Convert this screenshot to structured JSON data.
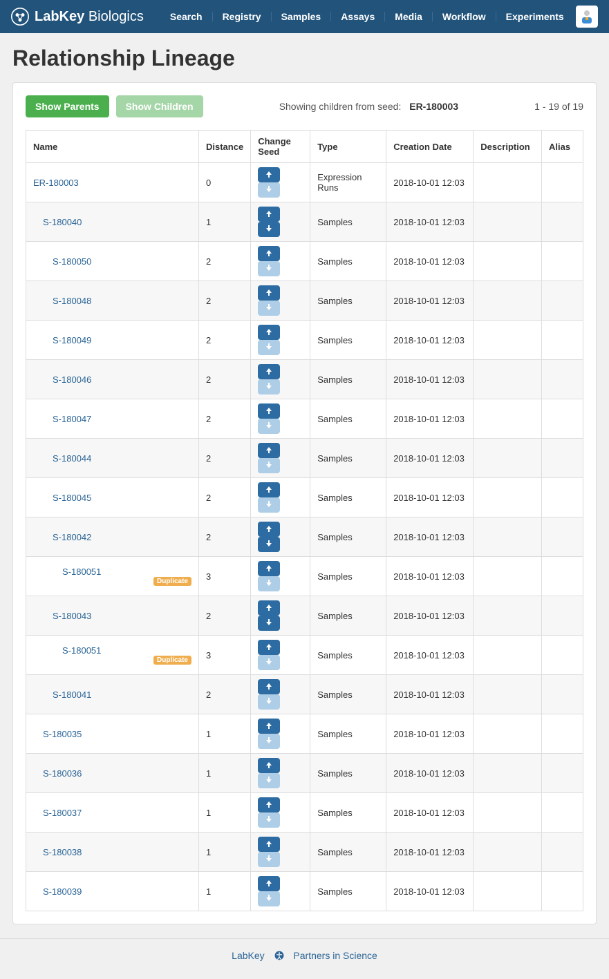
{
  "brand": {
    "name1": "LabKey",
    "name2": "Biologics"
  },
  "nav": [
    "Search",
    "Registry",
    "Samples",
    "Assays",
    "Media",
    "Workflow",
    "Experiments"
  ],
  "page_title": "Relationship Lineage",
  "buttons": {
    "parents": "Show Parents",
    "children": "Show Children"
  },
  "seed_label": "Showing children from seed:",
  "seed_value": "ER-180003",
  "count": "1 - 19 of 19",
  "columns": [
    "Name",
    "Distance",
    "Change Seed",
    "Type",
    "Creation Date",
    "Description",
    "Alias"
  ],
  "rows": [
    {
      "name": "ER-180003",
      "indent": 0,
      "distance": "0",
      "up": true,
      "down": false,
      "type": "Expression Runs",
      "date": "2018-10-01 12:03",
      "desc": "",
      "alias": "",
      "duplicate": false
    },
    {
      "name": "S-180040",
      "indent": 1,
      "distance": "1",
      "up": true,
      "down": true,
      "type": "Samples",
      "date": "2018-10-01 12:03",
      "desc": "",
      "alias": "",
      "duplicate": false
    },
    {
      "name": "S-180050",
      "indent": 2,
      "distance": "2",
      "up": true,
      "down": false,
      "type": "Samples",
      "date": "2018-10-01 12:03",
      "desc": "",
      "alias": "",
      "duplicate": false
    },
    {
      "name": "S-180048",
      "indent": 2,
      "distance": "2",
      "up": true,
      "down": false,
      "type": "Samples",
      "date": "2018-10-01 12:03",
      "desc": "",
      "alias": "",
      "duplicate": false
    },
    {
      "name": "S-180049",
      "indent": 2,
      "distance": "2",
      "up": true,
      "down": false,
      "type": "Samples",
      "date": "2018-10-01 12:03",
      "desc": "",
      "alias": "",
      "duplicate": false
    },
    {
      "name": "S-180046",
      "indent": 2,
      "distance": "2",
      "up": true,
      "down": false,
      "type": "Samples",
      "date": "2018-10-01 12:03",
      "desc": "",
      "alias": "",
      "duplicate": false
    },
    {
      "name": "S-180047",
      "indent": 2,
      "distance": "2",
      "up": true,
      "down": false,
      "type": "Samples",
      "date": "2018-10-01 12:03",
      "desc": "",
      "alias": "",
      "duplicate": false
    },
    {
      "name": "S-180044",
      "indent": 2,
      "distance": "2",
      "up": true,
      "down": false,
      "type": "Samples",
      "date": "2018-10-01 12:03",
      "desc": "",
      "alias": "",
      "duplicate": false
    },
    {
      "name": "S-180045",
      "indent": 2,
      "distance": "2",
      "up": true,
      "down": false,
      "type": "Samples",
      "date": "2018-10-01 12:03",
      "desc": "",
      "alias": "",
      "duplicate": false
    },
    {
      "name": "S-180042",
      "indent": 2,
      "distance": "2",
      "up": true,
      "down": true,
      "type": "Samples",
      "date": "2018-10-01 12:03",
      "desc": "",
      "alias": "",
      "duplicate": false
    },
    {
      "name": "S-180051",
      "indent": 3,
      "distance": "3",
      "up": true,
      "down": false,
      "type": "Samples",
      "date": "2018-10-01 12:03",
      "desc": "",
      "alias": "",
      "duplicate": true
    },
    {
      "name": "S-180043",
      "indent": 2,
      "distance": "2",
      "up": true,
      "down": true,
      "type": "Samples",
      "date": "2018-10-01 12:03",
      "desc": "",
      "alias": "",
      "duplicate": false
    },
    {
      "name": "S-180051",
      "indent": 3,
      "distance": "3",
      "up": true,
      "down": false,
      "type": "Samples",
      "date": "2018-10-01 12:03",
      "desc": "",
      "alias": "",
      "duplicate": true
    },
    {
      "name": "S-180041",
      "indent": 2,
      "distance": "2",
      "up": true,
      "down": false,
      "type": "Samples",
      "date": "2018-10-01 12:03",
      "desc": "",
      "alias": "",
      "duplicate": false
    },
    {
      "name": "S-180035",
      "indent": 1,
      "distance": "1",
      "up": true,
      "down": false,
      "type": "Samples",
      "date": "2018-10-01 12:03",
      "desc": "",
      "alias": "",
      "duplicate": false
    },
    {
      "name": "S-180036",
      "indent": 1,
      "distance": "1",
      "up": true,
      "down": false,
      "type": "Samples",
      "date": "2018-10-01 12:03",
      "desc": "",
      "alias": "",
      "duplicate": false
    },
    {
      "name": "S-180037",
      "indent": 1,
      "distance": "1",
      "up": true,
      "down": false,
      "type": "Samples",
      "date": "2018-10-01 12:03",
      "desc": "",
      "alias": "",
      "duplicate": false
    },
    {
      "name": "S-180038",
      "indent": 1,
      "distance": "1",
      "up": true,
      "down": false,
      "type": "Samples",
      "date": "2018-10-01 12:03",
      "desc": "",
      "alias": "",
      "duplicate": false
    },
    {
      "name": "S-180039",
      "indent": 1,
      "distance": "1",
      "up": true,
      "down": false,
      "type": "Samples",
      "date": "2018-10-01 12:03",
      "desc": "",
      "alias": "",
      "duplicate": false
    }
  ],
  "duplicate_label": "Duplicate",
  "footer": {
    "labkey": "LabKey",
    "partners": "Partners in Science"
  }
}
